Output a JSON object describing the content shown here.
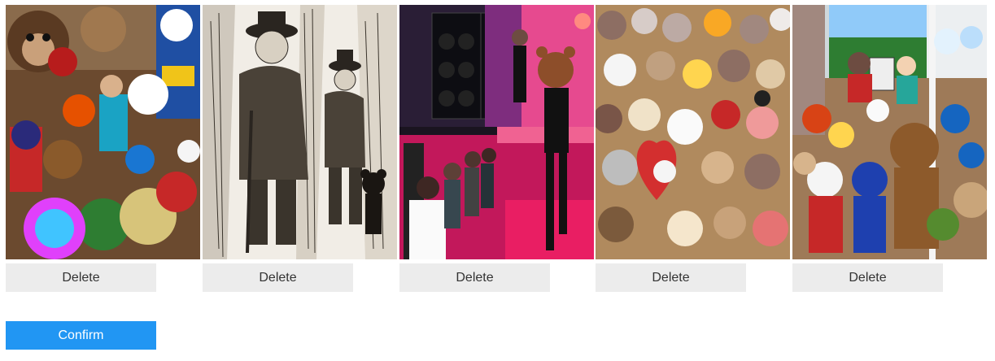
{
  "images": [
    {
      "kind": "teddy-bear-wall",
      "delete_label": "Delete"
    },
    {
      "kind": "engraving-illustration",
      "delete_label": "Delete"
    },
    {
      "kind": "concert-stage-bear-mask",
      "delete_label": "Delete"
    },
    {
      "kind": "teddy-bear-pile",
      "delete_label": "Delete"
    },
    {
      "kind": "teddy-bear-porch",
      "delete_label": "Delete"
    }
  ],
  "confirm": {
    "label": "Confirm"
  },
  "colors": {
    "confirm_bg": "#2196f3",
    "delete_bg": "#ececec",
    "delete_text": "#333333"
  }
}
